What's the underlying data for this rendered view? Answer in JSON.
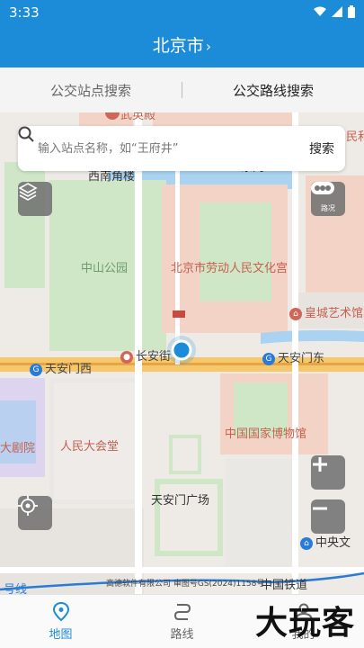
{
  "status": {
    "time": "3:33"
  },
  "header": {
    "city": "北京市",
    "chevron": "›"
  },
  "tabs": [
    {
      "label": "公交站点搜索"
    },
    {
      "label": "公交路线搜索"
    }
  ],
  "search": {
    "placeholder": "输入站点名称，如“王府井”",
    "button": "搜索"
  },
  "map": {
    "labels": {
      "wumen": "武英殿",
      "xinanjiao": "西南角楼",
      "zhongshan_park": "中山公园",
      "labor_palace": "北京市劳动人民文化宫",
      "huangcheng": "皇城艺术馆",
      "changanjie": "长安街",
      "tiananmen_west": "天安门西",
      "tiananmen_east": "天安门东",
      "national_museum": "中国国家博物馆",
      "great_hall": "人民大会堂",
      "theatre": "大剧院",
      "square": "天安门广场",
      "central_art": "中央文",
      "railway": "中国铁道",
      "minzu": "民和",
      "line1": "号线",
      "east_gate": "东门"
    },
    "traffic_label": "路况",
    "attribution": "高德软件有限公司 审图号GS(2024)1158号"
  },
  "nav": [
    {
      "label": "地图",
      "icon": "map-pin-icon"
    },
    {
      "label": "路线",
      "icon": "route-icon"
    },
    {
      "label": "我的",
      "icon": "user-icon"
    }
  ],
  "watermark": "大玩客",
  "colors": {
    "primary": "#1d8cd8",
    "park": "#cde6c4",
    "building": "#f4d6c9",
    "water": "#a9d3f0"
  }
}
